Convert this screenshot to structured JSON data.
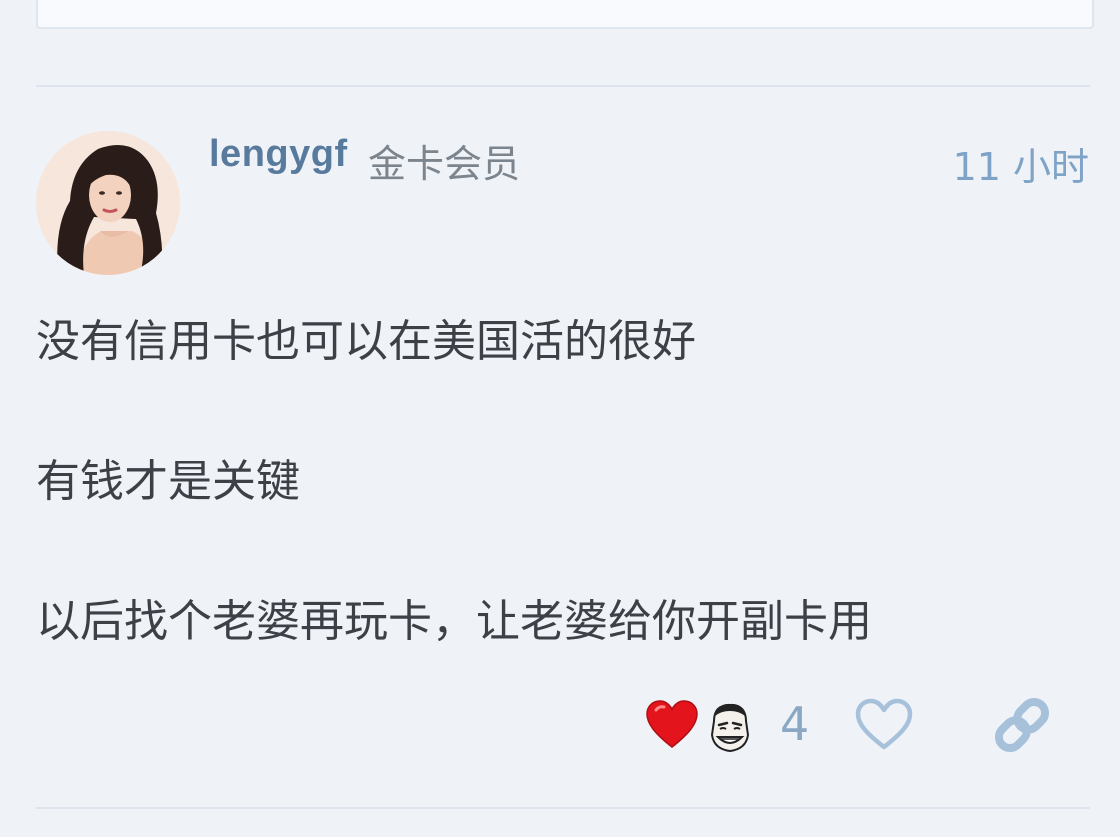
{
  "post": {
    "username": "lengygf",
    "user_title": "金卡会员",
    "time": "11 小时",
    "avatar_icon": "user-avatar",
    "paragraphs": [
      "没有信用卡也可以在美国活的很好",
      "有钱才是关键",
      "以后找个老婆再玩卡，让老婆给你开副卡用"
    ]
  },
  "actions": {
    "reactions": [
      {
        "icon": "red-heart-emoji"
      },
      {
        "icon": "laughing-meme-face-emoji"
      }
    ],
    "reaction_count": "4",
    "like_icon": "heart-outline-icon",
    "share_icon": "link-icon"
  },
  "colors": {
    "background": "#eff3f8",
    "username": "#577a9d",
    "user_title": "#7c848d",
    "time": "#7fa3c6",
    "body_text": "#3d4147",
    "action_icons": "#a7c1db"
  }
}
